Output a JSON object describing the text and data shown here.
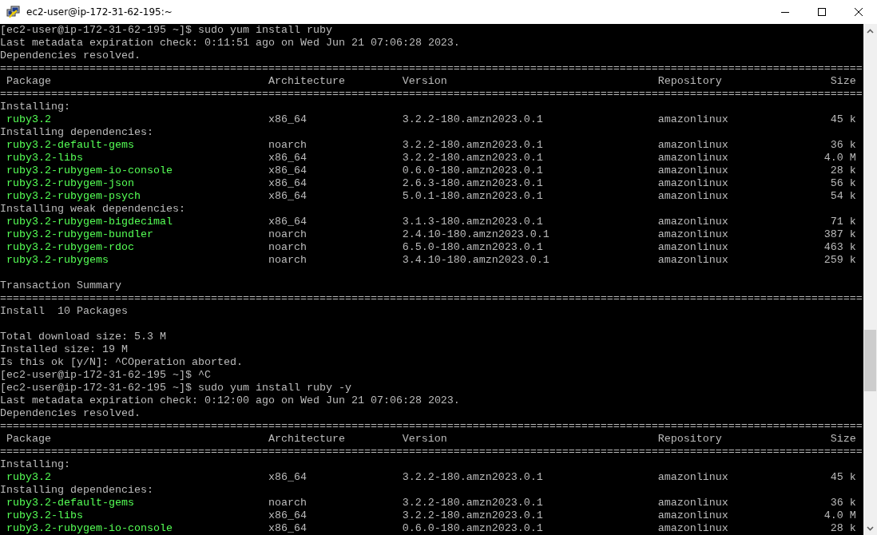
{
  "window": {
    "title": "ec2-user@ip-172-31-62-195:~"
  },
  "terminal": {
    "lines": [
      {
        "kind": "text",
        "text": "[ec2-user@ip-172-31-62-195 ~]$ sudo yum install ruby"
      },
      {
        "kind": "text",
        "text": "Last metadata expiration check: 0:11:51 ago on Wed Jun 21 07:06:28 2023."
      },
      {
        "kind": "text",
        "text": "Dependencies resolved."
      },
      {
        "kind": "rule",
        "text": "======================================================================================================================================="
      },
      {
        "kind": "header",
        "cells": [
          "Package",
          "Architecture",
          "Version",
          "Repository",
          "Size"
        ]
      },
      {
        "kind": "rule",
        "text": "======================================================================================================================================="
      },
      {
        "kind": "text",
        "text": "Installing:"
      },
      {
        "kind": "package",
        "cells": [
          "ruby3.2",
          "x86_64",
          "3.2.2-180.amzn2023.0.1",
          "amazonlinux",
          "45 k"
        ]
      },
      {
        "kind": "text",
        "text": "Installing dependencies:"
      },
      {
        "kind": "package",
        "cells": [
          "ruby3.2-default-gems",
          "noarch",
          "3.2.2-180.amzn2023.0.1",
          "amazonlinux",
          "36 k"
        ]
      },
      {
        "kind": "package",
        "cells": [
          "ruby3.2-libs",
          "x86_64",
          "3.2.2-180.amzn2023.0.1",
          "amazonlinux",
          "4.0 M"
        ]
      },
      {
        "kind": "package",
        "cells": [
          "ruby3.2-rubygem-io-console",
          "x86_64",
          "0.6.0-180.amzn2023.0.1",
          "amazonlinux",
          "28 k"
        ]
      },
      {
        "kind": "package",
        "cells": [
          "ruby3.2-rubygem-json",
          "x86_64",
          "2.6.3-180.amzn2023.0.1",
          "amazonlinux",
          "56 k"
        ]
      },
      {
        "kind": "package",
        "cells": [
          "ruby3.2-rubygem-psych",
          "x86_64",
          "5.0.1-180.amzn2023.0.1",
          "amazonlinux",
          "54 k"
        ]
      },
      {
        "kind": "text",
        "text": "Installing weak dependencies:"
      },
      {
        "kind": "package",
        "cells": [
          "ruby3.2-rubygem-bigdecimal",
          "x86_64",
          "3.1.3-180.amzn2023.0.1",
          "amazonlinux",
          "71 k"
        ]
      },
      {
        "kind": "package",
        "cells": [
          "ruby3.2-rubygem-bundler",
          "noarch",
          "2.4.10-180.amzn2023.0.1",
          "amazonlinux",
          "387 k"
        ]
      },
      {
        "kind": "package",
        "cells": [
          "ruby3.2-rubygem-rdoc",
          "noarch",
          "6.5.0-180.amzn2023.0.1",
          "amazonlinux",
          "463 k"
        ]
      },
      {
        "kind": "package",
        "cells": [
          "ruby3.2-rubygems",
          "noarch",
          "3.4.10-180.amzn2023.0.1",
          "amazonlinux",
          "259 k"
        ]
      },
      {
        "kind": "blank"
      },
      {
        "kind": "text",
        "text": "Transaction Summary"
      },
      {
        "kind": "rule",
        "text": "======================================================================================================================================="
      },
      {
        "kind": "text",
        "text": "Install  10 Packages"
      },
      {
        "kind": "blank"
      },
      {
        "kind": "text",
        "text": "Total download size: 5.3 M"
      },
      {
        "kind": "text",
        "text": "Installed size: 19 M"
      },
      {
        "kind": "text",
        "text": "Is this ok [y/N]: ^COperation aborted."
      },
      {
        "kind": "text",
        "text": "[ec2-user@ip-172-31-62-195 ~]$ ^C"
      },
      {
        "kind": "text",
        "text": "[ec2-user@ip-172-31-62-195 ~]$ sudo yum install ruby -y"
      },
      {
        "kind": "text",
        "text": "Last metadata expiration check: 0:12:00 ago on Wed Jun 21 07:06:28 2023."
      },
      {
        "kind": "text",
        "text": "Dependencies resolved."
      },
      {
        "kind": "rule",
        "text": "======================================================================================================================================="
      },
      {
        "kind": "header",
        "cells": [
          "Package",
          "Architecture",
          "Version",
          "Repository",
          "Size"
        ]
      },
      {
        "kind": "rule",
        "text": "======================================================================================================================================="
      },
      {
        "kind": "text",
        "text": "Installing:"
      },
      {
        "kind": "package",
        "cells": [
          "ruby3.2",
          "x86_64",
          "3.2.2-180.amzn2023.0.1",
          "amazonlinux",
          "45 k"
        ]
      },
      {
        "kind": "text",
        "text": "Installing dependencies:"
      },
      {
        "kind": "package",
        "cells": [
          "ruby3.2-default-gems",
          "noarch",
          "3.2.2-180.amzn2023.0.1",
          "amazonlinux",
          "36 k"
        ]
      },
      {
        "kind": "package",
        "cells": [
          "ruby3.2-libs",
          "x86_64",
          "3.2.2-180.amzn2023.0.1",
          "amazonlinux",
          "4.0 M"
        ]
      },
      {
        "kind": "package",
        "cells": [
          "ruby3.2-rubygem-io-console",
          "x86_64",
          "0.6.0-180.amzn2023.0.1",
          "amazonlinux",
          "28 k"
        ]
      }
    ]
  }
}
